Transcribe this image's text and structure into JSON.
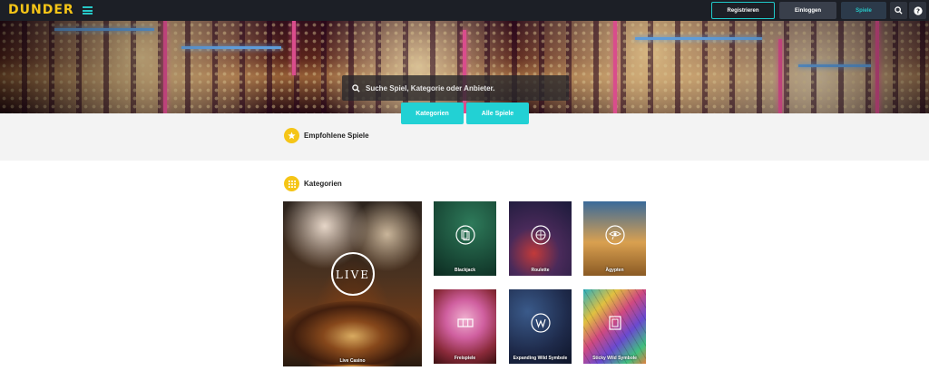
{
  "header": {
    "logo": "DUNDER",
    "register_label": "Registrieren",
    "login_label": "Einloggen",
    "games_label": "Spiele",
    "icons": [
      "menu-icon",
      "search-icon",
      "help-icon"
    ]
  },
  "search": {
    "placeholder": "Suche Spiel, Kategorie oder Anbieter."
  },
  "nav_pills": {
    "categories_label": "Kategorien",
    "all_games_label": "Alle Spiele"
  },
  "sections": {
    "featured_title": "Empfohlene Spiele",
    "categories_title": "Kategorien"
  },
  "tiles": [
    {
      "label": "Live Casino",
      "icon": "live-emblem-icon"
    },
    {
      "label": "Blackjack",
      "icon": "cards-icon"
    },
    {
      "label": "Roulette",
      "icon": "roulette-icon"
    },
    {
      "label": "Ägypten",
      "icon": "eye-of-horus-icon"
    },
    {
      "label": "Freispiele",
      "icon": "freespins-icon"
    },
    {
      "label": "Expanding Wild Symbole",
      "icon": "w-symbol-icon"
    },
    {
      "label": "Sticky Wild Symbole",
      "icon": "sticky-symbol-icon"
    }
  ],
  "live_emblem_text": "LIVE",
  "colors": {
    "accent_teal": "#22d1d4",
    "brand_yellow": "#f5c517",
    "topbar_bg": "#1c1f26"
  }
}
